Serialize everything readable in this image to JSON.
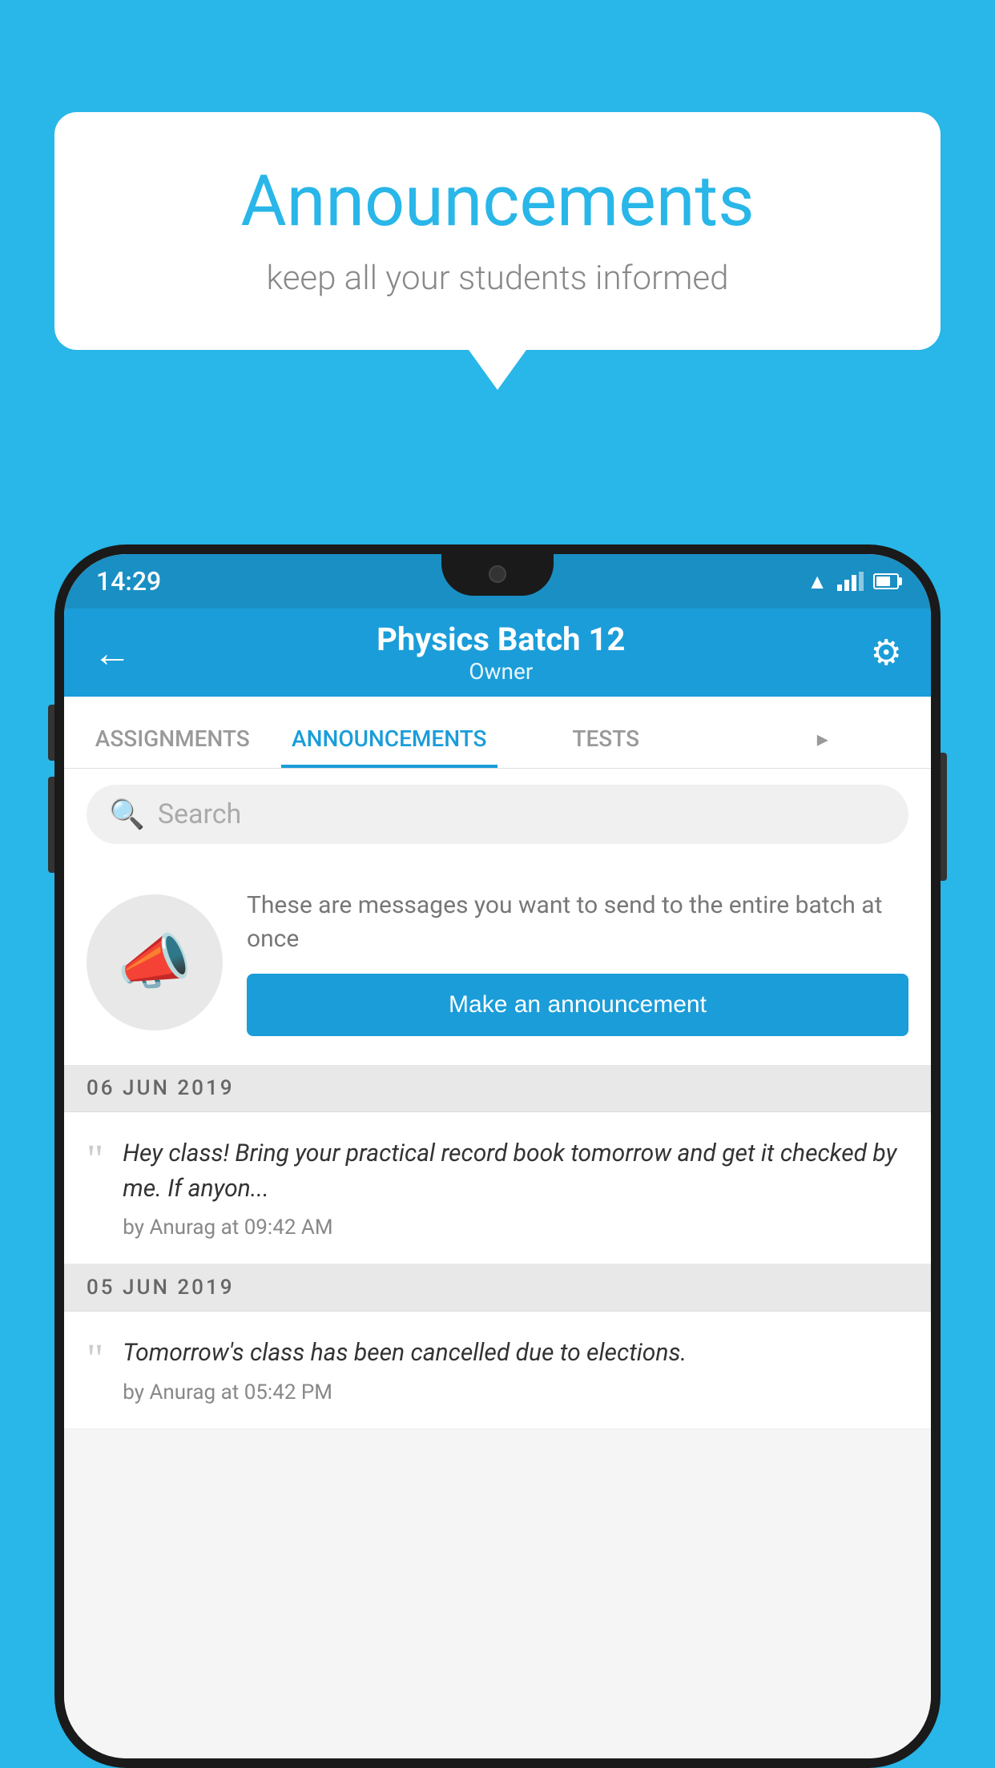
{
  "page": {
    "background_color": "#29b6e8"
  },
  "speech_bubble": {
    "title": "Announcements",
    "subtitle": "keep all your students informed"
  },
  "status_bar": {
    "time": "14:29"
  },
  "app_header": {
    "title": "Physics Batch 12",
    "subtitle": "Owner",
    "back_label": "←",
    "gear_label": "⚙"
  },
  "tabs": [
    {
      "label": "ASSIGNMENTS",
      "active": false
    },
    {
      "label": "ANNOUNCEMENTS",
      "active": true
    },
    {
      "label": "TESTS",
      "active": false
    },
    {
      "label": "···",
      "active": false
    }
  ],
  "search": {
    "placeholder": "Search"
  },
  "announcement_intro": {
    "description": "These are messages you want to send to the entire batch at once",
    "button_label": "Make an announcement"
  },
  "date_groups": [
    {
      "date": "06  JUN  2019",
      "messages": [
        {
          "text": "Hey class! Bring your practical record book tomorrow and get it checked by me. If anyon...",
          "meta": "by Anurag at 09:42 AM"
        }
      ]
    },
    {
      "date": "05  JUN  2019",
      "messages": [
        {
          "text": "Tomorrow's class has been cancelled due to elections.",
          "meta": "by Anurag at 05:42 PM"
        }
      ]
    }
  ]
}
